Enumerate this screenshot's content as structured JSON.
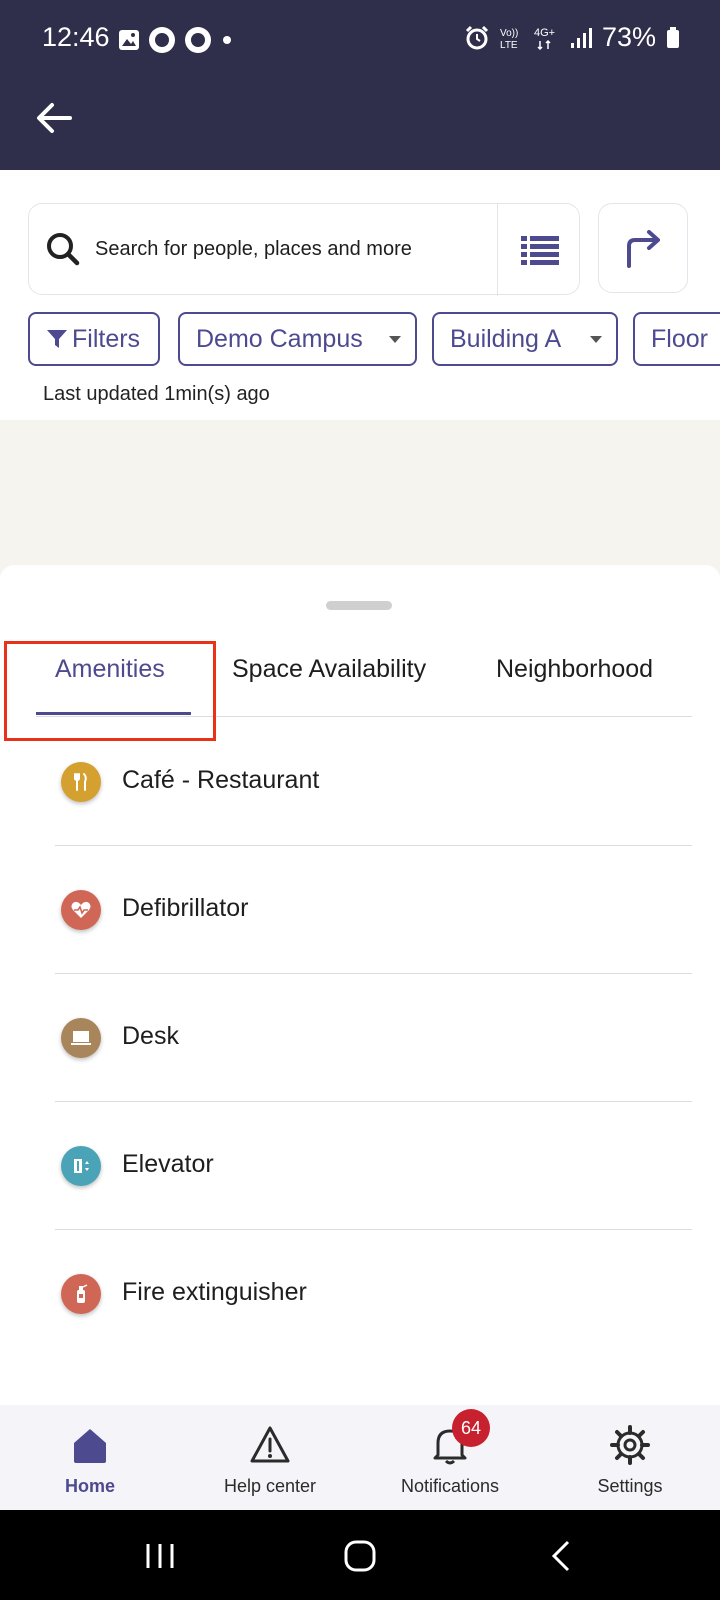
{
  "status_bar": {
    "time": "12:46",
    "battery": "73%",
    "network": "4G+",
    "volte": "VoLTE"
  },
  "search": {
    "placeholder": "Search for people, places and more"
  },
  "filters": {
    "filters_label": "Filters",
    "campus": "Demo Campus",
    "building": "Building A",
    "floor": "Floor"
  },
  "last_updated": "Last updated 1min(s) ago",
  "tabs": [
    {
      "label": "Amenities",
      "active": true
    },
    {
      "label": "Space Availability",
      "active": false
    },
    {
      "label": "Neighborhood",
      "active": false
    }
  ],
  "amenities": [
    {
      "label": "Café - Restaurant",
      "icon": "fork-knife-icon",
      "color": "#d4a030"
    },
    {
      "label": "Defibrillator",
      "icon": "heart-pulse-icon",
      "color": "#d06655"
    },
    {
      "label": "Desk",
      "icon": "laptop-icon",
      "color": "#a8855a"
    },
    {
      "label": "Elevator",
      "icon": "elevator-icon",
      "color": "#4aa3b6"
    },
    {
      "label": "Fire extinguisher",
      "icon": "fire-extinguisher-icon",
      "color": "#d06655"
    }
  ],
  "bottom_nav": {
    "home": "Home",
    "help": "Help center",
    "notifications": "Notifications",
    "notifications_count": "64",
    "settings": "Settings"
  },
  "colors": {
    "accent": "#4d4a8f",
    "app_bar": "#2f2f4b",
    "highlight": "#e8321a",
    "badge": "#c7202e"
  }
}
